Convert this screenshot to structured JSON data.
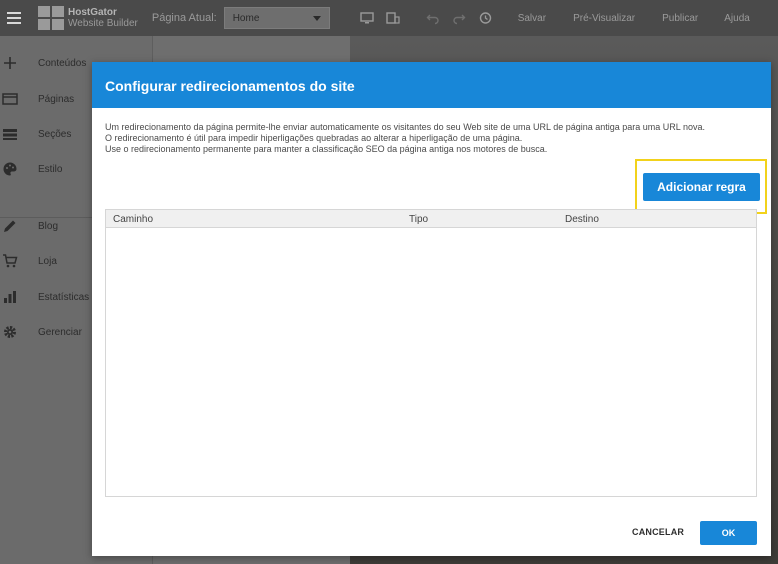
{
  "app": {
    "brand_name": "HostGator",
    "brand_sub": "Website Builder",
    "current_page_label": "Página Atual:",
    "current_page_value": "Home",
    "toolbar": {
      "save": "Salvar",
      "preview": "Pré-Visualizar",
      "publish": "Publicar",
      "help": "Ajuda"
    }
  },
  "sidebar": {
    "items": [
      {
        "label": "Conteúdos",
        "icon": "plus-icon"
      },
      {
        "label": "Páginas",
        "icon": "pages-icon"
      },
      {
        "label": "Seções",
        "icon": "sections-icon"
      },
      {
        "label": "Estilo",
        "icon": "palette-icon"
      },
      {
        "label": "Blog",
        "icon": "pencil-icon"
      },
      {
        "label": "Loja",
        "icon": "cart-icon"
      },
      {
        "label": "Estatísticas",
        "icon": "bar-chart-icon"
      },
      {
        "label": "Gerenciar",
        "icon": "gear-icon"
      }
    ]
  },
  "modal": {
    "title": "Configurar redirecionamentos do site",
    "description": [
      "Um redirecionamento da página permite-lhe enviar automaticamente os visitantes do seu Web site de uma URL de página antiga para uma URL nova.",
      "O redirecionamento é útil para impedir hiperligações quebradas ao alterar a hiperligação de uma página.",
      "Use o redirecionamento permanente para manter a classificação SEO da página antiga nos motores de busca."
    ],
    "add_rule_button": "Adicionar regra",
    "table": {
      "columns": [
        "Caminho",
        "Tipo",
        "Destino"
      ],
      "rows": []
    },
    "cancel_button": "CANCELAR",
    "ok_button": "OK"
  },
  "colors": {
    "accent": "#1887d8",
    "highlight": "#f2d21b",
    "overlay_topbar": "#4a4a4a",
    "overlay_sidebar": "#6b6b6b"
  }
}
